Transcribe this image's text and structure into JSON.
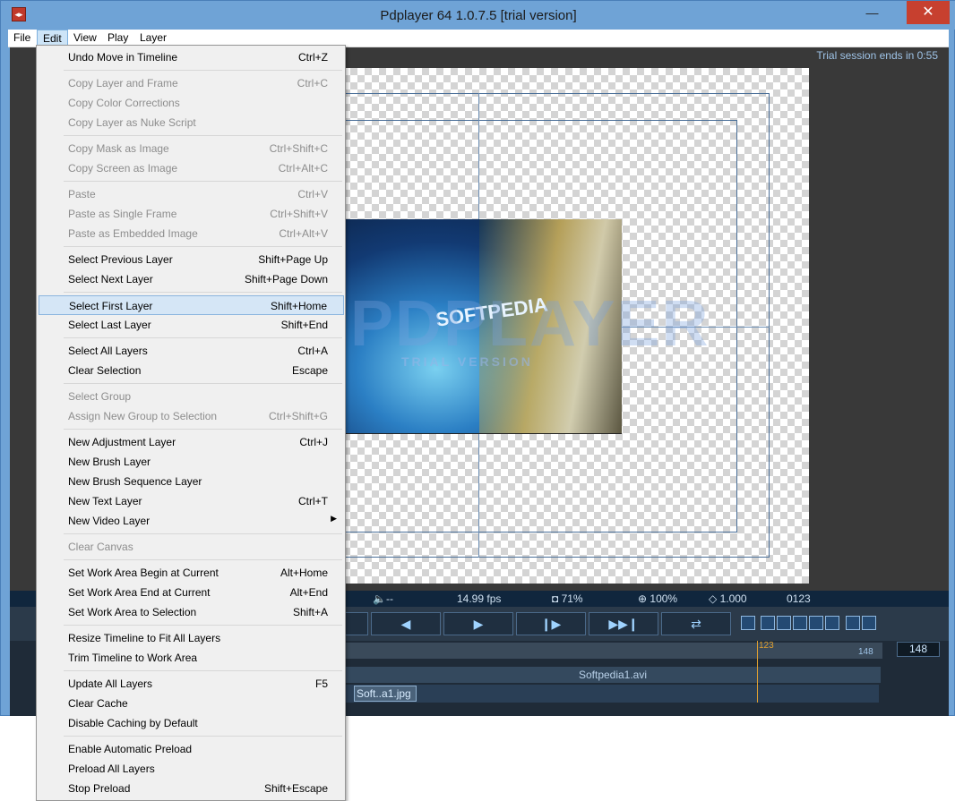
{
  "window": {
    "title": "Pdplayer 64 1.0.7.5 [trial version]",
    "minimize": "—",
    "maximize": "▢",
    "close": "✕"
  },
  "menubar": [
    "File",
    "Edit",
    "View",
    "Play",
    "Layer"
  ],
  "trial_notice": "Trial session ends in 0:55",
  "watermark": {
    "big": "PDPLAYER",
    "small": "TRIAL VERSION",
    "video_text": "SOFTPEDIA"
  },
  "status": {
    "audio": "🔈--",
    "fps": "14.99 fps",
    "opacity": "◘ 71%",
    "zoom": "⊕ 100%",
    "aspect": "◇ 1.000",
    "frame": "0123"
  },
  "controls": {
    "back": "◀",
    "play": "▶",
    "step": "❙▶",
    "end": "▶▶❙",
    "loop": "⇄"
  },
  "timeline": {
    "current": "123",
    "end": "148",
    "frame_value": "148",
    "track1": "Softpedia1.avi",
    "clip2": "Soft..a1.jpg"
  },
  "edit_menu": [
    {
      "label": "Undo Move in Timeline",
      "shortcut": "Ctrl+Z",
      "disabled": false
    },
    {
      "sep": true
    },
    {
      "label": "Copy Layer and Frame",
      "shortcut": "Ctrl+C",
      "disabled": true
    },
    {
      "label": "Copy Color Corrections",
      "shortcut": "",
      "disabled": true
    },
    {
      "label": "Copy Layer as Nuke Script",
      "shortcut": "",
      "disabled": true
    },
    {
      "sep": true
    },
    {
      "label": "Copy Mask as Image",
      "shortcut": "Ctrl+Shift+C",
      "disabled": true
    },
    {
      "label": "Copy Screen as Image",
      "shortcut": "Ctrl+Alt+C",
      "disabled": true
    },
    {
      "sep": true
    },
    {
      "label": "Paste",
      "shortcut": "Ctrl+V",
      "disabled": true
    },
    {
      "label": "Paste as Single Frame",
      "shortcut": "Ctrl+Shift+V",
      "disabled": true
    },
    {
      "label": "Paste as Embedded Image",
      "shortcut": "Ctrl+Alt+V",
      "disabled": true
    },
    {
      "sep": true
    },
    {
      "label": "Select Previous Layer",
      "shortcut": "Shift+Page Up",
      "disabled": false
    },
    {
      "label": "Select Next Layer",
      "shortcut": "Shift+Page Down",
      "disabled": false
    },
    {
      "sep": true
    },
    {
      "label": "Select First Layer",
      "shortcut": "Shift+Home",
      "disabled": false,
      "highlight": true
    },
    {
      "label": "Select Last Layer",
      "shortcut": "Shift+End",
      "disabled": false
    },
    {
      "sep": true
    },
    {
      "label": "Select All Layers",
      "shortcut": "Ctrl+A",
      "disabled": false
    },
    {
      "label": "Clear Selection",
      "shortcut": "Escape",
      "disabled": false
    },
    {
      "sep": true
    },
    {
      "label": "Select Group",
      "shortcut": "",
      "disabled": true
    },
    {
      "label": "Assign New Group to Selection",
      "shortcut": "Ctrl+Shift+G",
      "disabled": true
    },
    {
      "sep": true
    },
    {
      "label": "New Adjustment Layer",
      "shortcut": "Ctrl+J",
      "disabled": false
    },
    {
      "label": "New Brush Layer",
      "shortcut": "",
      "disabled": false
    },
    {
      "label": "New Brush Sequence Layer",
      "shortcut": "",
      "disabled": false
    },
    {
      "label": "New Text Layer",
      "shortcut": "Ctrl+T",
      "disabled": false
    },
    {
      "label": "New Video Layer",
      "shortcut": "",
      "disabled": false,
      "submenu": true
    },
    {
      "sep": true
    },
    {
      "label": "Clear Canvas",
      "shortcut": "",
      "disabled": true
    },
    {
      "sep": true
    },
    {
      "label": "Set Work Area Begin at Current",
      "shortcut": "Alt+Home",
      "disabled": false
    },
    {
      "label": "Set Work Area End at Current",
      "shortcut": "Alt+End",
      "disabled": false
    },
    {
      "label": "Set Work Area to Selection",
      "shortcut": "Shift+A",
      "disabled": false
    },
    {
      "sep": true
    },
    {
      "label": "Resize Timeline to Fit All Layers",
      "shortcut": "",
      "disabled": false
    },
    {
      "label": "Trim Timeline to Work Area",
      "shortcut": "",
      "disabled": false
    },
    {
      "sep": true
    },
    {
      "label": "Update All Layers",
      "shortcut": "F5",
      "disabled": false
    },
    {
      "label": "Clear Cache",
      "shortcut": "",
      "disabled": false
    },
    {
      "label": "Disable Caching by Default",
      "shortcut": "",
      "disabled": false
    },
    {
      "sep": true
    },
    {
      "label": "Enable Automatic Preload",
      "shortcut": "",
      "disabled": false
    },
    {
      "label": "Preload All Layers",
      "shortcut": "",
      "disabled": false
    },
    {
      "label": "Stop Preload",
      "shortcut": "Shift+Escape",
      "disabled": false
    }
  ]
}
